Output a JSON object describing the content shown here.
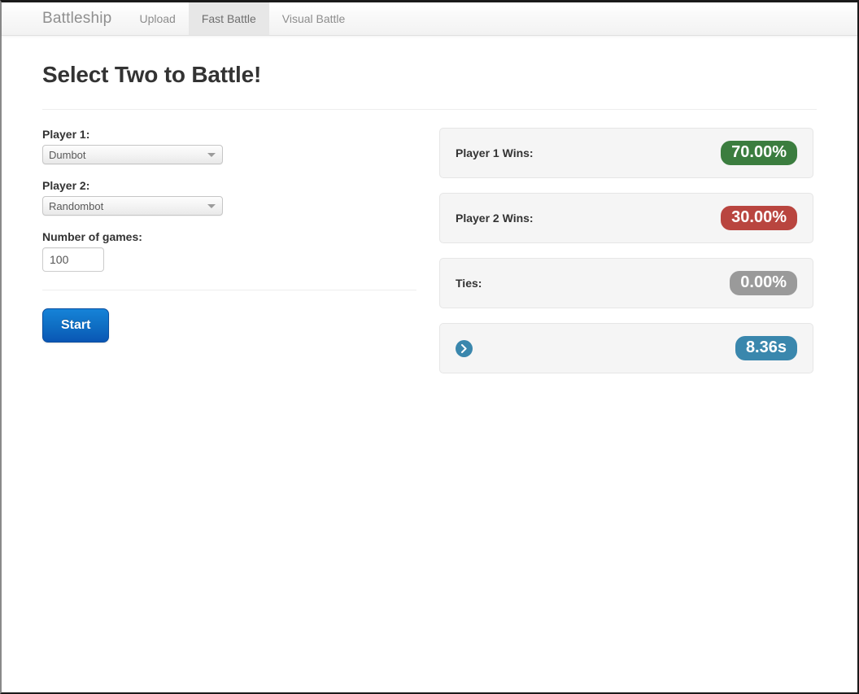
{
  "navbar": {
    "brand": "Battleship",
    "links": [
      {
        "label": "Upload",
        "active": false
      },
      {
        "label": "Fast Battle",
        "active": true
      },
      {
        "label": "Visual Battle",
        "active": false
      }
    ]
  },
  "page": {
    "title": "Select Two to Battle!"
  },
  "form": {
    "player1_label": "Player 1:",
    "player1_value": "Dumbot",
    "player2_label": "Player 2:",
    "player2_value": "Randombot",
    "games_label": "Number of games:",
    "games_value": "100",
    "games_placeholder": "100",
    "start_label": "Start"
  },
  "results": {
    "player1": {
      "label": "Player 1 Wins:",
      "value": "70.00%",
      "color": "#3b7d3f"
    },
    "player2": {
      "label": "Player 2 Wins:",
      "value": "30.00%",
      "color": "#b9453f"
    },
    "ties": {
      "label": "Ties:",
      "value": "0.00%",
      "color": "#9a9a9a"
    },
    "time": {
      "icon": "chevron-right-circle-icon",
      "value": "8.36s",
      "color": "#3a87ad"
    }
  }
}
